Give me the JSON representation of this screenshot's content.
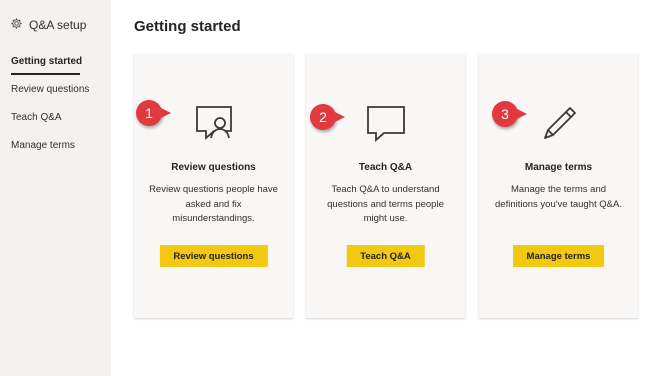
{
  "sidebar": {
    "title": "Q&A setup",
    "title_icon": "gear-icon",
    "items": [
      {
        "label": "Getting started",
        "active": true
      },
      {
        "label": "Review questions",
        "active": false
      },
      {
        "label": "Teach Q&A",
        "active": false
      },
      {
        "label": "Manage terms",
        "active": false
      }
    ]
  },
  "main": {
    "heading": "Getting started",
    "cards": [
      {
        "badge": "1",
        "icon": "chat-person-icon",
        "title": "Review questions",
        "description": "Review questions people have asked and fix misunderstandings.",
        "button": "Review questions"
      },
      {
        "badge": "2",
        "icon": "speech-bubble-icon",
        "title": "Teach Q&A",
        "description": "Teach Q&A to understand questions and terms people might use.",
        "button": "Teach Q&A"
      },
      {
        "badge": "3",
        "icon": "pencil-icon",
        "title": "Manage terms",
        "description": "Manage the terms and definitions you've taught Q&A.",
        "button": "Manage terms"
      }
    ]
  },
  "colors": {
    "accent": "#f2c811",
    "badge": "#e0393e",
    "sidebar_bg": "#f3f2f1"
  }
}
